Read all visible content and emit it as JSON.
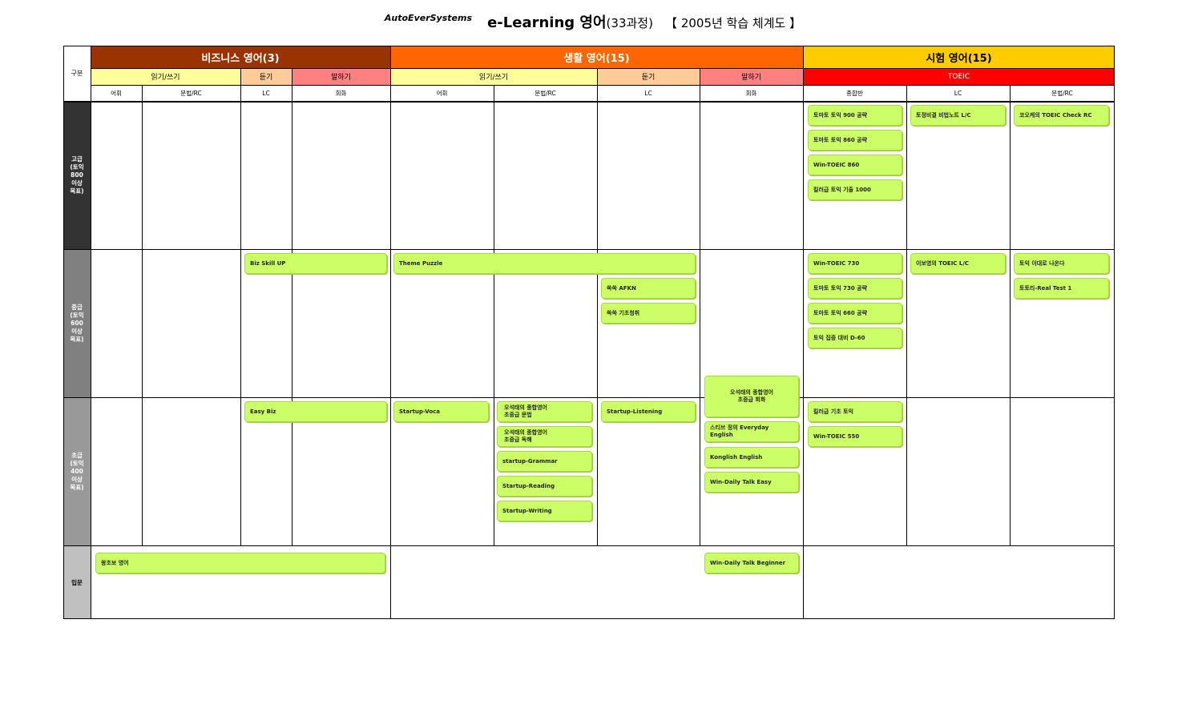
{
  "header": {
    "company": "AutoEverSystems",
    "title_main": "e-Learning 영어",
    "title_count": "(33과정)",
    "title_year": "【 2005년 학습 체계도 】"
  },
  "table": {
    "corner_label": "구분",
    "categories": [
      {
        "label": "비즈니스 영어(3)",
        "color": "#993300"
      },
      {
        "label": "생활 영어(15)",
        "color": "#ff6600"
      },
      {
        "label": "시험 영어(15)",
        "color": "#ffcc00"
      }
    ],
    "skills": [
      {
        "label": "읽기/쓰기",
        "color": "#ffff99"
      },
      {
        "label": "듣기",
        "color": "#ffcc99"
      },
      {
        "label": "말하기",
        "color": "#ff8080"
      },
      {
        "label": "읽기/쓰기",
        "color": "#ffff99"
      },
      {
        "label": "듣기",
        "color": "#ffcc99"
      },
      {
        "label": "말하기",
        "color": "#ff8080"
      },
      {
        "label": "TOEIC",
        "color": "#ff0000"
      }
    ],
    "columns": [
      "어휘",
      "문법/RC",
      "LC",
      "회화",
      "어휘",
      "문법/RC",
      "LC",
      "회화",
      "종합반",
      "LC",
      "문법/RC"
    ],
    "levels": [
      {
        "label": "고급\n(토익\n800\n이상\n목표)",
        "color": "#333333"
      },
      {
        "label": "중급\n(토익\n600\n이상\n목표)",
        "color": "#808080"
      },
      {
        "label": "초급\n(토익\n400\n이상\n목표)",
        "color": "#999999"
      },
      {
        "label": "입문",
        "color": "#c0c0c0"
      }
    ]
  },
  "courses": {
    "advanced": [
      "토마토 토익 900 공략",
      "토마토 토익 860 공략",
      "Win-TOEIC 860",
      "킬러급 토익 기출 1000",
      "토정비결 비법노트 L/C",
      "코오케의 TOEIC Check RC"
    ],
    "intermediate": [
      "Biz Skill UP",
      "Theme Puzzle",
      "쏙쏙 AFKN",
      "쏙쏙 기초청취",
      "오석태의 종합영어\n초중급 회화",
      "Win-TOEIC 730",
      "토마토 토익 730 공략",
      "토마토 토익 660 공략",
      "토익 집중 대비 D-60",
      "이보영의 TOEIC L/C",
      "토익 이대로 나온다",
      "토토리-Real Test 1"
    ],
    "beginner": [
      "Easy Biz",
      "Startup-Voca",
      "오석태의 종합영어\n초중급 문법",
      "오석태의 종합영어\n초중급 독해",
      "startup-Grammar",
      "Startup-Reading",
      "Startup-Writing",
      "Startup-Listening",
      "스티브 정의 Everyday\nEnglish",
      "Konglish English",
      "Win-Daily Talk Easy",
      "킬러급 기초 토익",
      "Win-TOEIC 550"
    ],
    "intro": [
      "왕초보 영어",
      "Win-Daily Talk Beginner"
    ]
  }
}
